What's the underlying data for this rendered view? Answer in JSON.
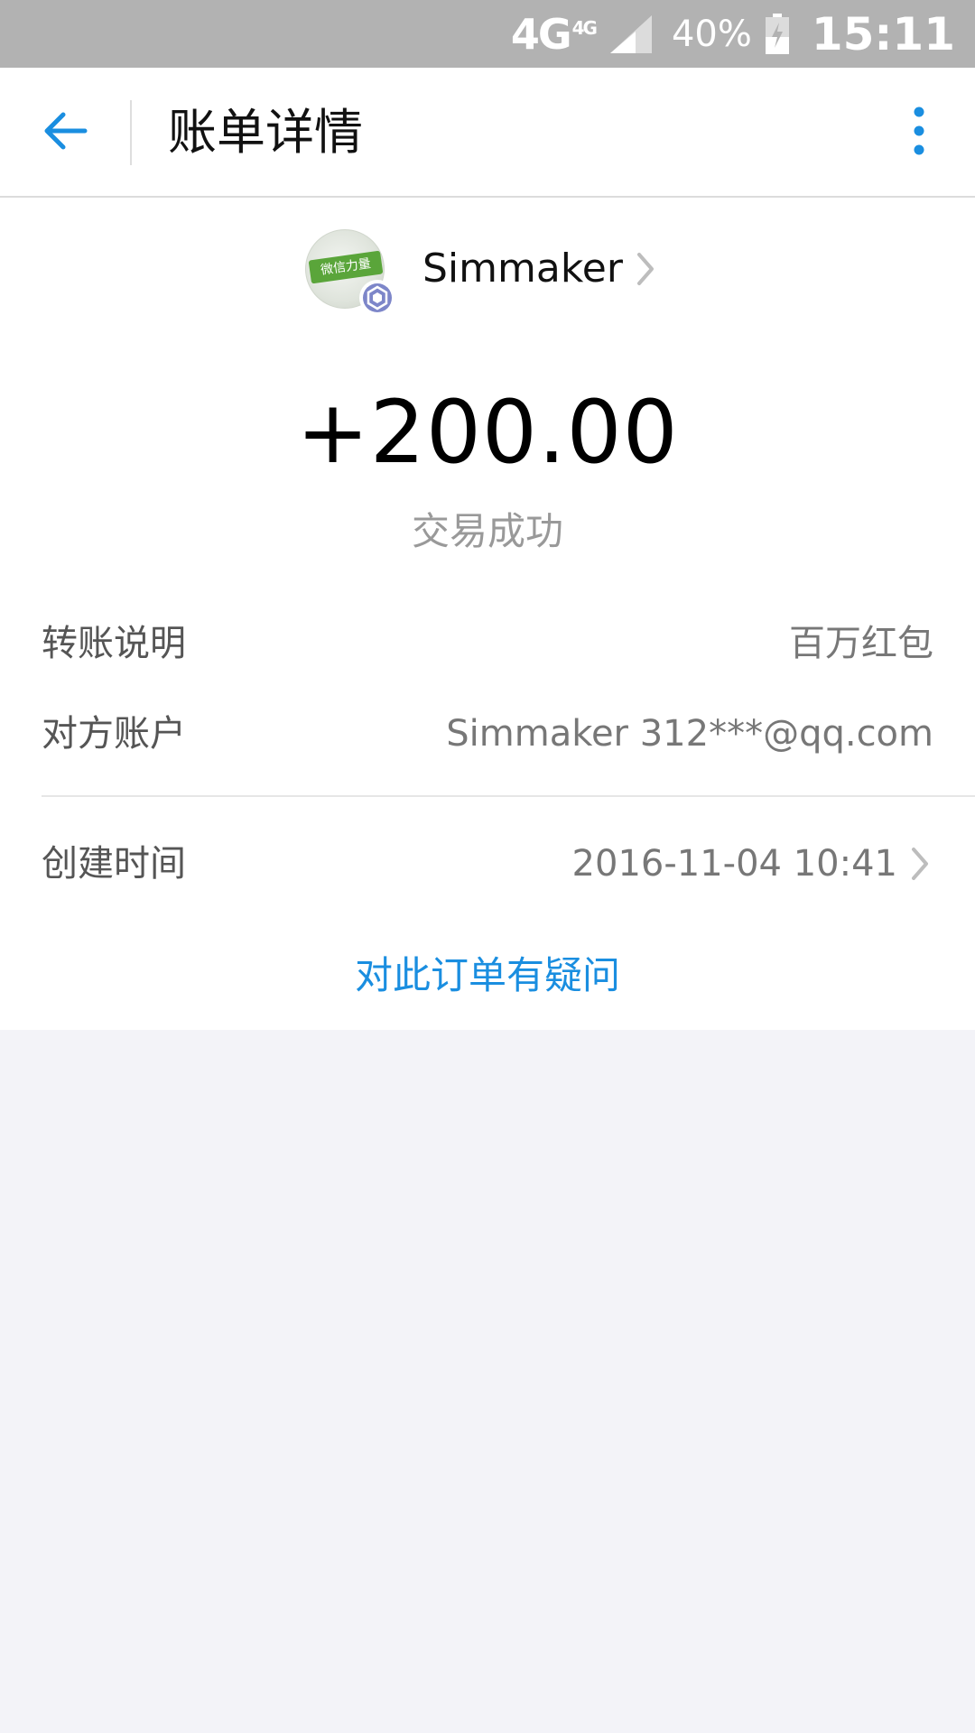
{
  "status_bar": {
    "network": "4G",
    "network_sup": "4G",
    "battery_percent": "40%",
    "time": "15:11",
    "signal_icon": "signal-icon",
    "battery_icon": "battery-icon"
  },
  "header": {
    "title": "账单详情",
    "back_icon": "arrow-left-icon",
    "more_icon": "more-vertical-icon",
    "accent_color": "#1a8ee0"
  },
  "merchant": {
    "name": "Simmaker",
    "avatar_logo_text": "微信力量",
    "badge_icon": "verified-badge-icon",
    "chevron_icon": "chevron-right-icon"
  },
  "transaction": {
    "amount": "+200.00",
    "status": "交易成功"
  },
  "details": {
    "transfer_note": {
      "label": "转账说明",
      "value": "百万红包"
    },
    "counterparty": {
      "label": "对方账户",
      "value": "Simmaker 312***@qq.com"
    },
    "created_time": {
      "label": "创建时间",
      "value": "2016-11-04 10:41"
    }
  },
  "actions": {
    "question_link": "对此订单有疑问"
  }
}
